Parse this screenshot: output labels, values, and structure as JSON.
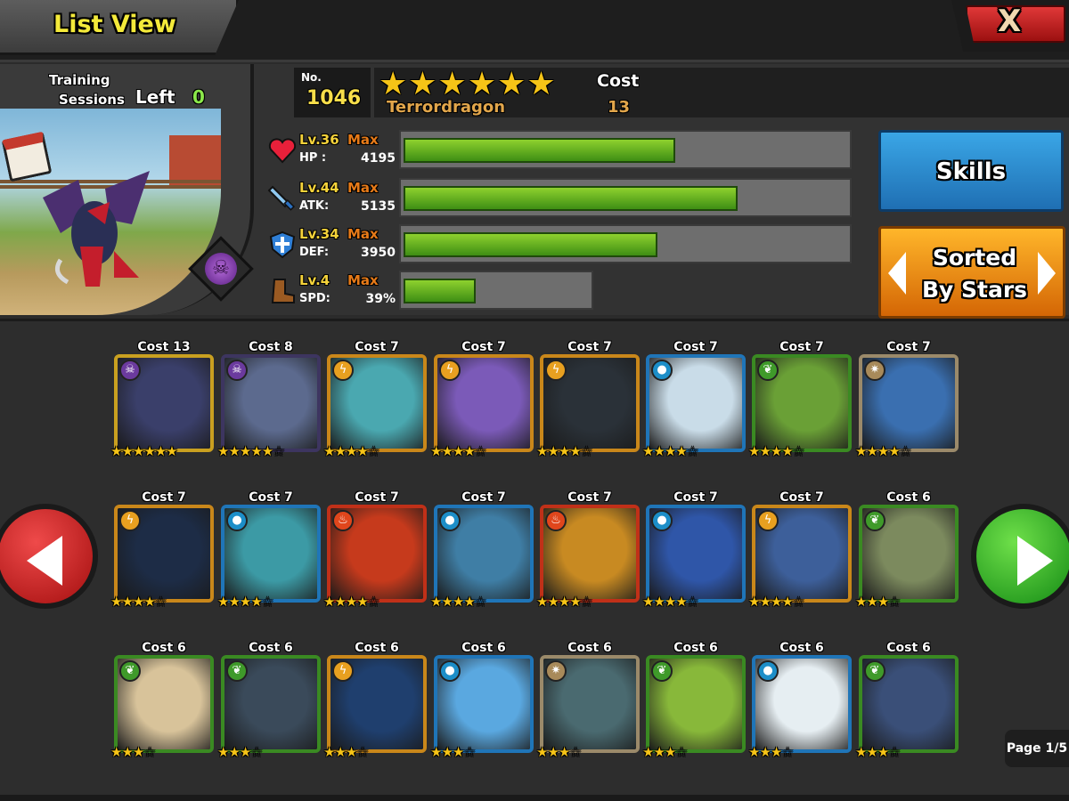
{
  "header": {
    "title": "List View",
    "close_label": "X"
  },
  "detail": {
    "training_label": "Training",
    "sessions_label": "Sessions",
    "left_label": "Left",
    "sessions_left": "0",
    "no_label": "No.",
    "number": "1046",
    "stars": "★★★★★★",
    "name": "Terrordragon",
    "cost_label": "Cost",
    "cost_value": "13",
    "element_icon": "skull-icon",
    "stats": [
      {
        "icon": "heart-icon",
        "level": "Lv.36",
        "max": "Max",
        "name": "HP :",
        "value": "4195",
        "fill": 0.61
      },
      {
        "icon": "sword-icon",
        "level": "Lv.44",
        "max": "Max",
        "name": "ATK:",
        "value": "5135",
        "fill": 0.75
      },
      {
        "icon": "shield-icon",
        "level": "Lv.34",
        "max": "Max",
        "name": "DEF:",
        "value": "3950",
        "fill": 0.57
      },
      {
        "icon": "boot-icon",
        "level": "Lv.4",
        "max": "Max",
        "name": "SPD:",
        "value": "39%",
        "fill": 0.39
      }
    ]
  },
  "buttons": {
    "skills": "Skills",
    "sort_line1": "Sorted",
    "sort_line2": "By Stars"
  },
  "cards": [
    {
      "cost": "Cost 13",
      "stars": 6,
      "max": 6,
      "element": "dark",
      "elem_color": "#6b3a9e",
      "frame": "#c9a020",
      "art": "#3a3f6a"
    },
    {
      "cost": "Cost 8",
      "stars": 5,
      "max": 6,
      "element": "dark",
      "elem_color": "#6b3a9e",
      "frame": "#3d3560",
      "art": "#5c6a8e"
    },
    {
      "cost": "Cost 7",
      "stars": 4,
      "max": 5,
      "element": "thunder",
      "elem_color": "#e8a020",
      "frame": "#c9871a",
      "art": "#4aa8b0"
    },
    {
      "cost": "Cost 7",
      "stars": 4,
      "max": 5,
      "element": "thunder",
      "elem_color": "#e8a020",
      "frame": "#c9871a",
      "art": "#7b5ab8"
    },
    {
      "cost": "Cost 7",
      "stars": 4,
      "max": 5,
      "element": "thunder",
      "elem_color": "#e8a020",
      "frame": "#c9871a",
      "art": "#2a3138"
    },
    {
      "cost": "Cost 7",
      "stars": 4,
      "max": 5,
      "element": "water",
      "elem_color": "#1c8ec8",
      "frame": "#1f75b8",
      "art": "#c9dce8"
    },
    {
      "cost": "Cost 7",
      "stars": 4,
      "max": 5,
      "element": "wood",
      "elem_color": "#3f9a2a",
      "frame": "#3a8a22",
      "art": "#6aa036"
    },
    {
      "cost": "Cost 7",
      "stars": 4,
      "max": 5,
      "element": "light",
      "elem_color": "#a88a5a",
      "frame": "#9b8a6a",
      "art": "#3a6fb0"
    },
    {
      "cost": "Cost 7",
      "stars": 4,
      "max": 5,
      "element": "thunder",
      "elem_color": "#e8a020",
      "frame": "#c9871a",
      "art": "#1d2c46"
    },
    {
      "cost": "Cost 7",
      "stars": 4,
      "max": 5,
      "element": "water",
      "elem_color": "#1c8ec8",
      "frame": "#1f75b8",
      "art": "#3c9aa5"
    },
    {
      "cost": "Cost 7",
      "stars": 4,
      "max": 5,
      "element": "fire",
      "elem_color": "#e0461c",
      "frame": "#c03018",
      "art": "#c63a1c"
    },
    {
      "cost": "Cost 7",
      "stars": 4,
      "max": 5,
      "element": "water",
      "elem_color": "#1c8ec8",
      "frame": "#1f75b8",
      "art": "#3f7ea5"
    },
    {
      "cost": "Cost 7",
      "stars": 4,
      "max": 5,
      "element": "fire",
      "elem_color": "#e0461c",
      "frame": "#c03018",
      "art": "#c88a22"
    },
    {
      "cost": "Cost 7",
      "stars": 4,
      "max": 5,
      "element": "water",
      "elem_color": "#1c8ec8",
      "frame": "#1f75b8",
      "art": "#2f56a8"
    },
    {
      "cost": "Cost 7",
      "stars": 4,
      "max": 5,
      "element": "thunder",
      "elem_color": "#e8a020",
      "frame": "#c9871a",
      "art": "#3d5f9a"
    },
    {
      "cost": "Cost 6",
      "stars": 3,
      "max": 4,
      "element": "wood",
      "elem_color": "#3f9a2a",
      "frame": "#3a8a22",
      "art": "#7c8a5e"
    },
    {
      "cost": "Cost 6",
      "stars": 3,
      "max": 4,
      "element": "wood",
      "elem_color": "#3f9a2a",
      "frame": "#3a8a22",
      "art": "#d8c39a"
    },
    {
      "cost": "Cost 6",
      "stars": 3,
      "max": 4,
      "element": "wood",
      "elem_color": "#3f9a2a",
      "frame": "#3a8a22",
      "art": "#3a4a5a"
    },
    {
      "cost": "Cost 6",
      "stars": 3,
      "max": 4,
      "element": "thunder",
      "elem_color": "#e8a020",
      "frame": "#c9871a",
      "art": "#1f3f6e"
    },
    {
      "cost": "Cost 6",
      "stars": 3,
      "max": 4,
      "element": "water",
      "elem_color": "#1c8ec8",
      "frame": "#1f75b8",
      "art": "#5aa8e0"
    },
    {
      "cost": "Cost 6",
      "stars": 3,
      "max": 4,
      "element": "light",
      "elem_color": "#a88a5a",
      "frame": "#9b8a6a",
      "art": "#4a6a70"
    },
    {
      "cost": "Cost 6",
      "stars": 3,
      "max": 4,
      "element": "wood",
      "elem_color": "#3f9a2a",
      "frame": "#3a8a22",
      "art": "#88b83a"
    },
    {
      "cost": "Cost 6",
      "stars": 3,
      "max": 4,
      "element": "water",
      "elem_color": "#1c8ec8",
      "frame": "#1f75b8",
      "art": "#e6eef2"
    },
    {
      "cost": "Cost 6",
      "stars": 3,
      "max": 4,
      "element": "wood",
      "elem_color": "#3f9a2a",
      "frame": "#3a8a22",
      "art": "#3a4f78"
    }
  ],
  "element_glyphs": {
    "dark": "☠",
    "thunder": "ϟ",
    "water": "●",
    "wood": "❦",
    "fire": "♨",
    "light": "✷"
  },
  "page": "Page 1/5"
}
